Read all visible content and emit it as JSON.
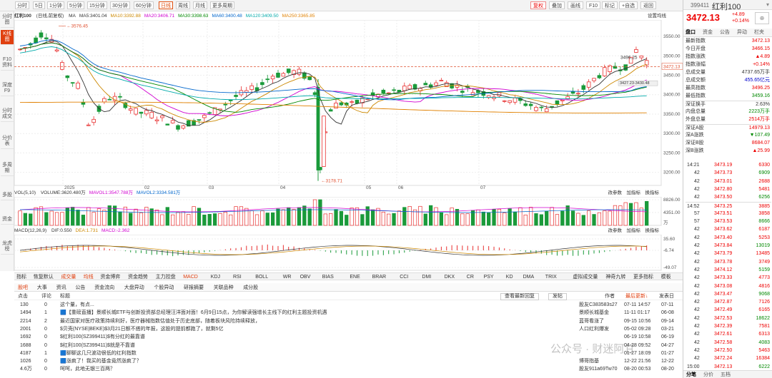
{
  "toolbar": {
    "timeframes": [
      "分时",
      "5日",
      "1分钟",
      "5分钟",
      "15分钟",
      "30分钟",
      "60分钟",
      "日线",
      "周线",
      "月线",
      "更多周期"
    ],
    "active_tf": "日线",
    "buttons": [
      "复权",
      "叠加",
      "画线",
      "F10",
      "标记",
      "+自选",
      "返回"
    ]
  },
  "left_nav": [
    "分时图",
    "K线图",
    "F10资料",
    "深度F9",
    "分时成交",
    "分价表",
    "多周期",
    "多股",
    "资金",
    "龙虎榜"
  ],
  "chart": {
    "title": "红利100",
    "fq": "(日线,前复权)",
    "ma": [
      {
        "label": "MA",
        "value": "",
        "color": "#333"
      },
      {
        "label": "MA5:3401.04",
        "color": "#333"
      },
      {
        "label": "MA10:3392.88",
        "color": "#cc8800"
      },
      {
        "label": "MA20:3406.71",
        "color": "#d000d0"
      },
      {
        "label": "MA30:3398.63",
        "color": "#008800"
      },
      {
        "label": "MA60:3400.48",
        "color": "#0066cc"
      },
      {
        "label": "MA120:3409.50",
        "color": "#00aaaa"
      },
      {
        "label": "MA250:3365.85",
        "color": "#e08000"
      }
    ],
    "settings": "设置均线",
    "y_ticks": [
      "3550.00",
      "3500.00",
      "3450.00",
      "3400.00",
      "3350.00",
      "3300.00",
      "3250.00",
      "3200.00"
    ],
    "current_tag": "3472.13",
    "high_tag": "3576.45",
    "low_tag": "3178.71",
    "peak_tag": "3496.25",
    "mid_tag": "3427.23",
    "mid_tag2": "3430.48",
    "x_labels": [
      "2025",
      "02",
      "03",
      "04",
      "05",
      "06",
      "07"
    ],
    "last_close": "3472.13"
  },
  "volume": {
    "title": "VOL(5,10)",
    "items": [
      {
        "label": "VOLUME:3620.480万",
        "color": "#333"
      },
      {
        "label": "MAVOL1:3547.788万",
        "color": "#d000d0"
      },
      {
        "label": "MAVOL2:3334.581万",
        "color": "#0066cc"
      }
    ],
    "y_ticks": [
      "8826.00",
      "4351.00"
    ],
    "unit": "万",
    "tools": [
      "改参数",
      "加指标",
      "换指标"
    ]
  },
  "macd": {
    "title": "MACD(12,26,9)",
    "items": [
      {
        "label": "DIF:0.550",
        "color": "#333"
      },
      {
        "label": "DEA:1.731",
        "color": "#cc8800"
      },
      {
        "label": "MACD:-2.362",
        "color": "#d000d0"
      }
    ],
    "y_ticks": [
      "35.60",
      "-6.74",
      "-49.07"
    ],
    "tools": [
      "改参数",
      "加指标",
      "换指标"
    ]
  },
  "indicator_bar": [
    "指标",
    "恢复默认",
    "成交量",
    "均线",
    "资金博弈",
    "资金趋势",
    "主力控盘",
    "MACD",
    "KDJ",
    "RSI",
    "BOLL",
    "WR",
    "OBV",
    "BIAS",
    "ENE",
    "BRAR",
    "CCI",
    "DMI",
    "DKX",
    "CR",
    "PSY",
    "KD",
    "DMA",
    "TRIX",
    "虚拟成交量",
    "神奇九转",
    "更多指标",
    "模板"
  ],
  "news_tabs": [
    "股吧",
    "大事",
    "资讯",
    "公告",
    "资金流向",
    "大盘异动",
    "个股异动",
    "研报摘要",
    "关联品种",
    "成分股"
  ],
  "news_head": {
    "clicks": "点击",
    "comments": "评论",
    "title": "标题",
    "filters": [
      "查看最新回复",
      "发帖"
    ],
    "author": "作者",
    "latest": "最后更新↓",
    "published": "发表日"
  },
  "news_rows": [
    {
      "c": "130",
      "r": "0",
      "t": "这个量，有点...",
      "a": "股友C383583s27",
      "u": "07-11 14:57",
      "p": "07-11"
    },
    {
      "c": "1494",
      "r": "1",
      "t": "🟦【重磅直播】景顺长城ETF与创新投资部总经理汪洋面对面！6月9日15点，为你解读强增长主线下的红利主题投资机遇",
      "a": "景顺长城基金",
      "u": "11-11 01:17",
      "p": "06-08"
    },
    {
      "c": "2214",
      "r": "2",
      "t": "最近国家对医疗政策持续利好，医疗器械指数估值处于历史底部，随着板块风险持续释放，",
      "a": "蓝哥看涨了",
      "u": "09-15 10:56",
      "p": "09-14"
    },
    {
      "c": "2001",
      "r": "0",
      "t": "$贝壳(NYSE|BEKE)$3月21日额不搭的年报，这股的提前都跑了，就剩5亿",
      "a": "人口红利爆发",
      "u": "05-02 09:28",
      "p": "03-21"
    },
    {
      "c": "1692",
      "r": "0",
      "t": "$红利100(SZ399411)$有分红的最靠谱",
      "a": "",
      "u": "06-19 10:58",
      "p": "06-19"
    },
    {
      "c": "1688",
      "r": "0",
      "t": "$红利100(SZ399411)$就是不靠谱",
      "a": "",
      "u": "04-28 09:52",
      "p": "04-27"
    },
    {
      "c": "4187",
      "r": "1",
      "t": "🟦聊聊这几只波动很低的红利指数",
      "a": "",
      "u": "01-27 18:09",
      "p": "01-27"
    },
    {
      "c": "1026",
      "r": "0",
      "t": "🟦涨疯了！我买的基金竟然涨疯了？",
      "a": "博哥指基",
      "u": "12-22 21:56",
      "p": "12-22"
    },
    {
      "c": "4.6万",
      "r": "0",
      "t": "呵呵，此地无银三百两？",
      "a": "股友911a69Tw70",
      "u": "08-20 00:53",
      "p": "08-20"
    }
  ],
  "watermark": "公众号 · 财迷阿甘",
  "quote": {
    "code": "399411",
    "name": "红利100",
    "price": "3472.13",
    "change": "+4.89",
    "change_pct": "+0.14%",
    "tabs": [
      "盘口",
      "资金",
      "公告",
      "异动",
      "栏夹"
    ],
    "rows": [
      {
        "l": "最新指数",
        "v": "3472.13",
        "c": "red"
      },
      {
        "l": "今日开盘",
        "v": "3466.15",
        "c": "red"
      },
      {
        "l": "指数涨跌",
        "v": "▲4.89",
        "c": "red"
      },
      {
        "l": "指数涨幅",
        "v": "+0.14%",
        "c": "red"
      },
      {
        "l": "总成交量",
        "v": "4737.65万手",
        "c": ""
      },
      {
        "l": "总成交额",
        "v": "455.65亿元",
        "c": "blu"
      },
      {
        "l": "最高指数",
        "v": "3496.25",
        "c": "red"
      },
      {
        "l": "最低指数",
        "v": "3459.16",
        "c": "grn"
      },
      {
        "l": "深证换手",
        "v": "2.63%",
        "c": ""
      },
      {
        "l": "内盘总量",
        "v": "2223万手",
        "c": "grn"
      },
      {
        "l": "外盘总量",
        "v": "2514万手",
        "c": "red"
      },
      {
        "l": "深证A股",
        "v": "14979.13",
        "c": "red"
      },
      {
        "l": "深A涨跌",
        "v": "▼107.49",
        "c": "grn"
      },
      {
        "l": "深证B股",
        "v": "8684.07",
        "c": "red"
      },
      {
        "l": "深B涨跌",
        "v": "▲25.99",
        "c": "red"
      }
    ]
  },
  "trades": [
    {
      "t": "14:21",
      "p": "3473.19",
      "v": "6330"
    },
    {
      "t": "42",
      "p": "3473.73",
      "v": "6909"
    },
    {
      "t": "42",
      "p": "3473.01",
      "v": "2688"
    },
    {
      "t": "42",
      "p": "3472.80",
      "v": "5481"
    },
    {
      "t": "42",
      "p": "3473.50",
      "v": "6256"
    },
    {
      "t": "14:52",
      "p": "3473.25",
      "v": "3885"
    },
    {
      "t": "57",
      "p": "3473.51",
      "v": "3858"
    },
    {
      "t": "57",
      "p": "3473.53",
      "v": "8666"
    },
    {
      "t": "42",
      "p": "3473.62",
      "v": "6187"
    },
    {
      "t": "42",
      "p": "3473.40",
      "v": "5253"
    },
    {
      "t": "42",
      "p": "3473.84",
      "v": "13019"
    },
    {
      "t": "42",
      "p": "3473.79",
      "v": "13485"
    },
    {
      "t": "42",
      "p": "3473.78",
      "v": "3749"
    },
    {
      "t": "42",
      "p": "3474.12",
      "v": "5159"
    },
    {
      "t": "42",
      "p": "3473.33",
      "v": "4773"
    },
    {
      "t": "42",
      "p": "3473.08",
      "v": "4816"
    },
    {
      "t": "42",
      "p": "3473.47",
      "v": "9068"
    },
    {
      "t": "42",
      "p": "3472.87",
      "v": "7126"
    },
    {
      "t": "42",
      "p": "3472.49",
      "v": "6165"
    },
    {
      "t": "42",
      "p": "3472.53",
      "v": "18622"
    },
    {
      "t": "42",
      "p": "3472.39",
      "v": "7581"
    },
    {
      "t": "42",
      "p": "3472.61",
      "v": "6313"
    },
    {
      "t": "42",
      "p": "3472.58",
      "v": "4083"
    },
    {
      "t": "42",
      "p": "3472.50",
      "v": "5463"
    },
    {
      "t": "42",
      "p": "3472.24",
      "v": "16384"
    },
    {
      "t": "15:00",
      "p": "3472.13",
      "v": "6222"
    }
  ],
  "bottom_tabs": [
    "分笔",
    "分价",
    "五档"
  ]
}
